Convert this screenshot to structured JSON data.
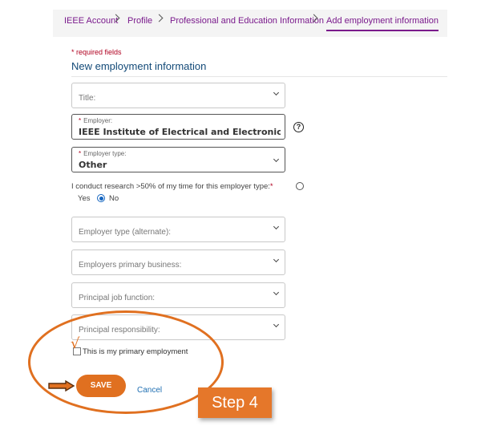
{
  "breadcrumb": {
    "items": [
      "IEEE Account",
      "Profile",
      "Professional and Education Information",
      "Add employment information"
    ]
  },
  "form": {
    "required_note": "* required fields",
    "heading": "New employment information",
    "title_placeholder": "Title:",
    "employer": {
      "label": "Employer:",
      "value": "IEEE Institute of Electrical and Electronics E"
    },
    "employer_type": {
      "label": "Employer type:",
      "value": "Other"
    },
    "research_question": "I conduct research >50% of my time for this employer type:",
    "research_yes": "Yes",
    "research_no": "No",
    "research_selected": "No",
    "employer_type_alt_placeholder": "Employer type (alternate):",
    "primary_business_placeholder": "Employers primary business:",
    "job_function_placeholder": "Principal job function:",
    "responsibility_placeholder": "Principal responsibility:",
    "primary_employment_label": "This is my primary employment",
    "primary_employment_checked": true,
    "save_label": "SAVE",
    "cancel_label": "Cancel"
  },
  "annotation": {
    "step_label": "Step 4",
    "highlight_color": "#e07020"
  },
  "icons": {
    "help": "help-circle-icon",
    "dropdown": "chevron-down-icon",
    "breadcrumb_separator": "chevron-right-icon"
  }
}
